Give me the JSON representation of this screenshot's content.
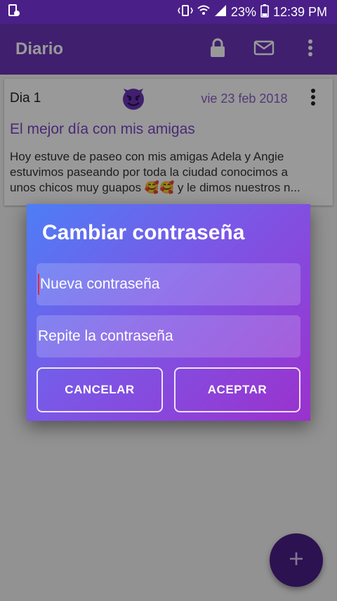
{
  "status_bar": {
    "battery_percent": "23%",
    "time": "12:39 PM",
    "icons": [
      "screen-record-icon",
      "vibrate-icon",
      "wifi-icon",
      "signal-icon",
      "battery-icon"
    ]
  },
  "app_bar": {
    "title": "Diario",
    "actions": [
      "lock-icon",
      "mail-icon",
      "more-vert-icon"
    ]
  },
  "entry_card": {
    "day_label": "Dia 1",
    "mood_icon": "devil-face-icon",
    "date": "vie 23 feb  2018",
    "title": "El mejor día con mis amigas",
    "text_line1": "Hoy estuve de paseo con mis amigas Adela y Angie",
    "text_line2": "estuvimos paseando por toda la ciudad conocimos a",
    "text_line3": "unos chicos muy guapos 🥰🥰  y le dimos nuestros n..."
  },
  "dialog": {
    "title": "Cambiar contraseña",
    "field1_placeholder": "Nueva contraseña",
    "field2_placeholder": "Repite la contraseña",
    "cancel_label": "CANCELAR",
    "accept_label": "ACEPTAR"
  },
  "fab": {
    "icon": "plus-icon"
  },
  "colors": {
    "primary_dark": "#4a1f88",
    "primary": "#6a35b8",
    "accent_text": "#7a46c4",
    "dialog_gradient_start": "#4d7ef6",
    "dialog_gradient_end": "#9b31cd"
  }
}
